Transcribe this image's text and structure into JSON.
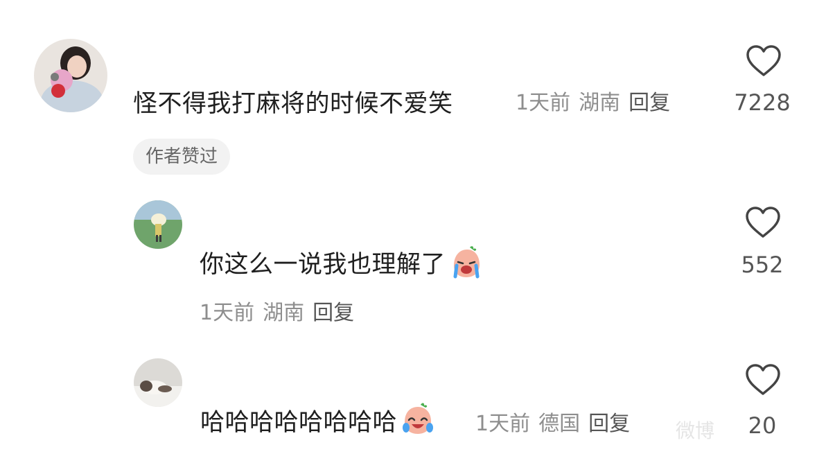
{
  "comments": [
    {
      "username": "",
      "text": "怪不得我打麻将的时候不爱笑",
      "time": "1天前",
      "location": "湖南",
      "reply_label": "回复",
      "likes": "7228",
      "badge": "作者赞过"
    },
    {
      "username": "",
      "text": "你这么一说我也理解了",
      "emoji": "loudly-crying-emoji",
      "time": "1天前",
      "location": "湖南",
      "reply_label": "回复",
      "likes": "552"
    },
    {
      "username": "",
      "text": "哈哈哈哈哈哈哈哈",
      "emoji": "tears-of-joy-emoji",
      "time": "1天前",
      "location": "德国",
      "reply_label": "回复",
      "likes": "20"
    }
  ],
  "watermark": "微博"
}
